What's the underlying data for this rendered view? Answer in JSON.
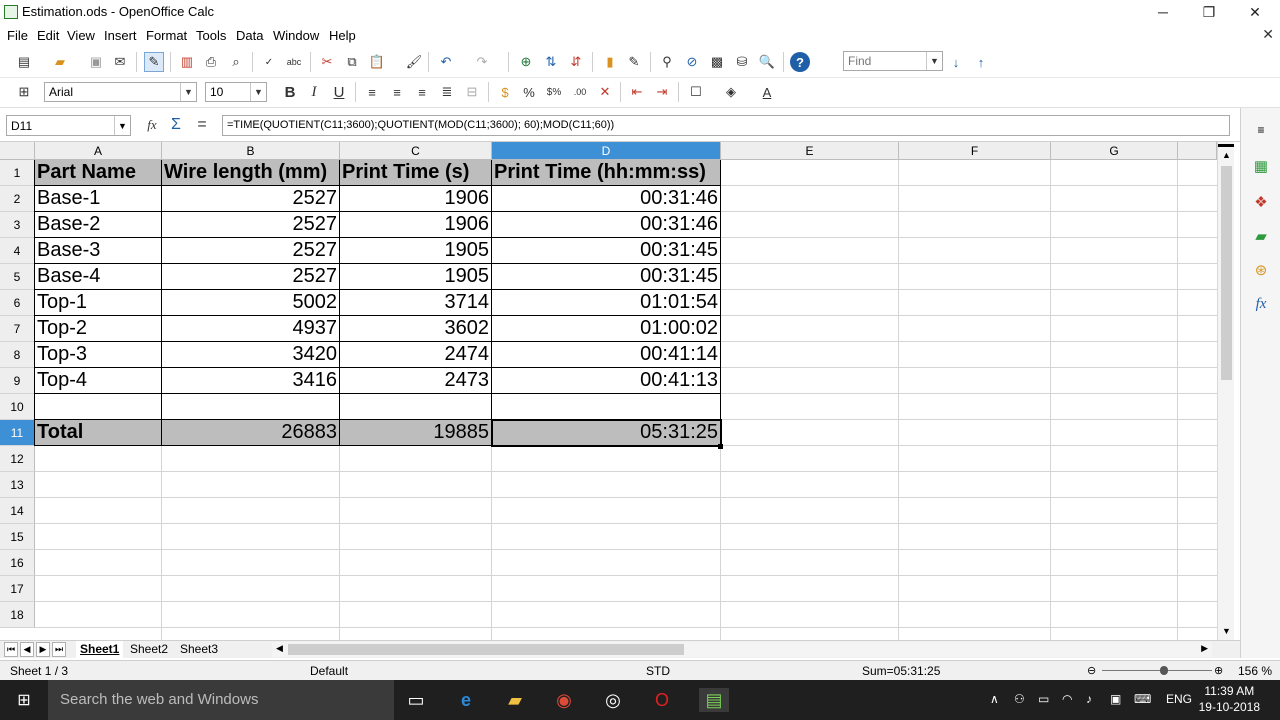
{
  "window": {
    "title": "Estimation.ods - OpenOffice Calc",
    "minimize": "─",
    "maximize": "❐",
    "close": "✕",
    "doc_close": "✕"
  },
  "menu": [
    "File",
    "Edit",
    "View",
    "Insert",
    "Format",
    "Tools",
    "Data",
    "Window",
    "Help"
  ],
  "toolbar": {
    "find_placeholder": "Find",
    "font_name": "Arial",
    "font_size": "10",
    "bold": "B",
    "italic": "I",
    "underline": "U",
    "percent": "%"
  },
  "formula_bar": {
    "cell_ref": "D11",
    "formula": "=TIME(QUOTIENT(C11;3600);QUOTIENT(MOD(C11;3600); 60);MOD(C11;60))",
    "sum_symbol": "Σ",
    "equals_symbol": "="
  },
  "grid": {
    "columns": [
      "A",
      "B",
      "C",
      "D",
      "E",
      "F",
      "G"
    ],
    "selected_column": "D",
    "selected_row": "11",
    "row_numbers": [
      "1",
      "2",
      "3",
      "4",
      "5",
      "6",
      "7",
      "8",
      "9",
      "10",
      "11",
      "12",
      "13",
      "14",
      "15",
      "16",
      "17",
      "18"
    ],
    "rows": [
      [
        "Part Name",
        "Wire length (mm)",
        "Print Time (s)",
        "Print Time (hh:mm:ss)"
      ],
      [
        "Base-1",
        "2527",
        "1906",
        "00:31:46"
      ],
      [
        "Base-2",
        "2527",
        "1906",
        "00:31:46"
      ],
      [
        "Base-3",
        "2527",
        "1905",
        "00:31:45"
      ],
      [
        "Base-4",
        "2527",
        "1905",
        "00:31:45"
      ],
      [
        "Top-1",
        "5002",
        "3714",
        "01:01:54"
      ],
      [
        "Top-2",
        "4937",
        "3602",
        "01:00:02"
      ],
      [
        "Top-3",
        "3420",
        "2474",
        "00:41:14"
      ],
      [
        "Top-4",
        "3416",
        "2473",
        "00:41:13"
      ],
      [
        "",
        "",
        "",
        ""
      ],
      [
        "Total",
        "26883",
        "19885",
        "05:31:25"
      ]
    ]
  },
  "sheets": {
    "tabs": [
      "Sheet1",
      "Sheet2",
      "Sheet3"
    ],
    "active": "Sheet1"
  },
  "status": {
    "sheet": "Sheet 1 / 3",
    "page_style": "Default",
    "selection_mode": "STD",
    "sum": "Sum=05:31:25",
    "zoom": "156 %"
  },
  "taskbar": {
    "search_placeholder": "Search the web and Windows",
    "language": "ENG",
    "time": "11:39 AM",
    "date": "19-10-2018"
  }
}
